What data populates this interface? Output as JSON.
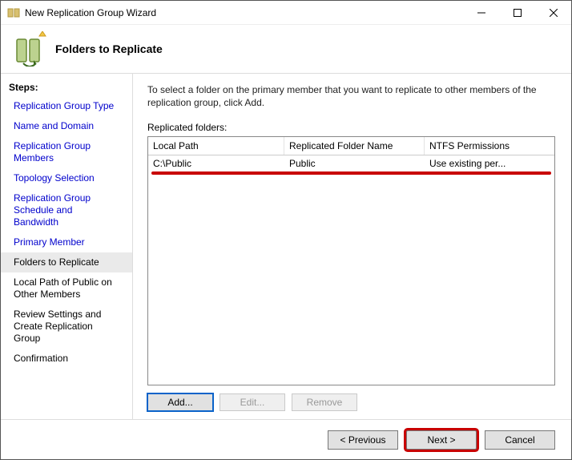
{
  "window": {
    "title": "New Replication Group Wizard"
  },
  "header": {
    "title": "Folders to Replicate"
  },
  "sidebar": {
    "heading": "Steps:",
    "items": [
      {
        "label": "Replication Group Type",
        "state": "past"
      },
      {
        "label": "Name and Domain",
        "state": "past"
      },
      {
        "label": "Replication Group Members",
        "state": "past"
      },
      {
        "label": "Topology Selection",
        "state": "past"
      },
      {
        "label": "Replication Group Schedule and Bandwidth",
        "state": "past"
      },
      {
        "label": "Primary Member",
        "state": "past"
      },
      {
        "label": "Folders to Replicate",
        "state": "current"
      },
      {
        "label": "Local Path of Public on Other Members",
        "state": "future"
      },
      {
        "label": "Review Settings and Create Replication Group",
        "state": "future"
      },
      {
        "label": "Confirmation",
        "state": "future"
      }
    ]
  },
  "main": {
    "intro": "To select a folder on the primary member that you want to replicate to other members of the replication group, click Add.",
    "list_label": "Replicated folders:",
    "columns": {
      "local_path": "Local Path",
      "replicated_name": "Replicated Folder Name",
      "ntfs": "NTFS Permissions"
    },
    "rows": [
      {
        "local_path": "C:\\Public",
        "replicated_name": "Public",
        "ntfs": "Use existing per..."
      }
    ],
    "buttons": {
      "add": "Add...",
      "edit": "Edit...",
      "remove": "Remove"
    }
  },
  "footer": {
    "previous": "< Previous",
    "next": "Next >",
    "cancel": "Cancel"
  }
}
